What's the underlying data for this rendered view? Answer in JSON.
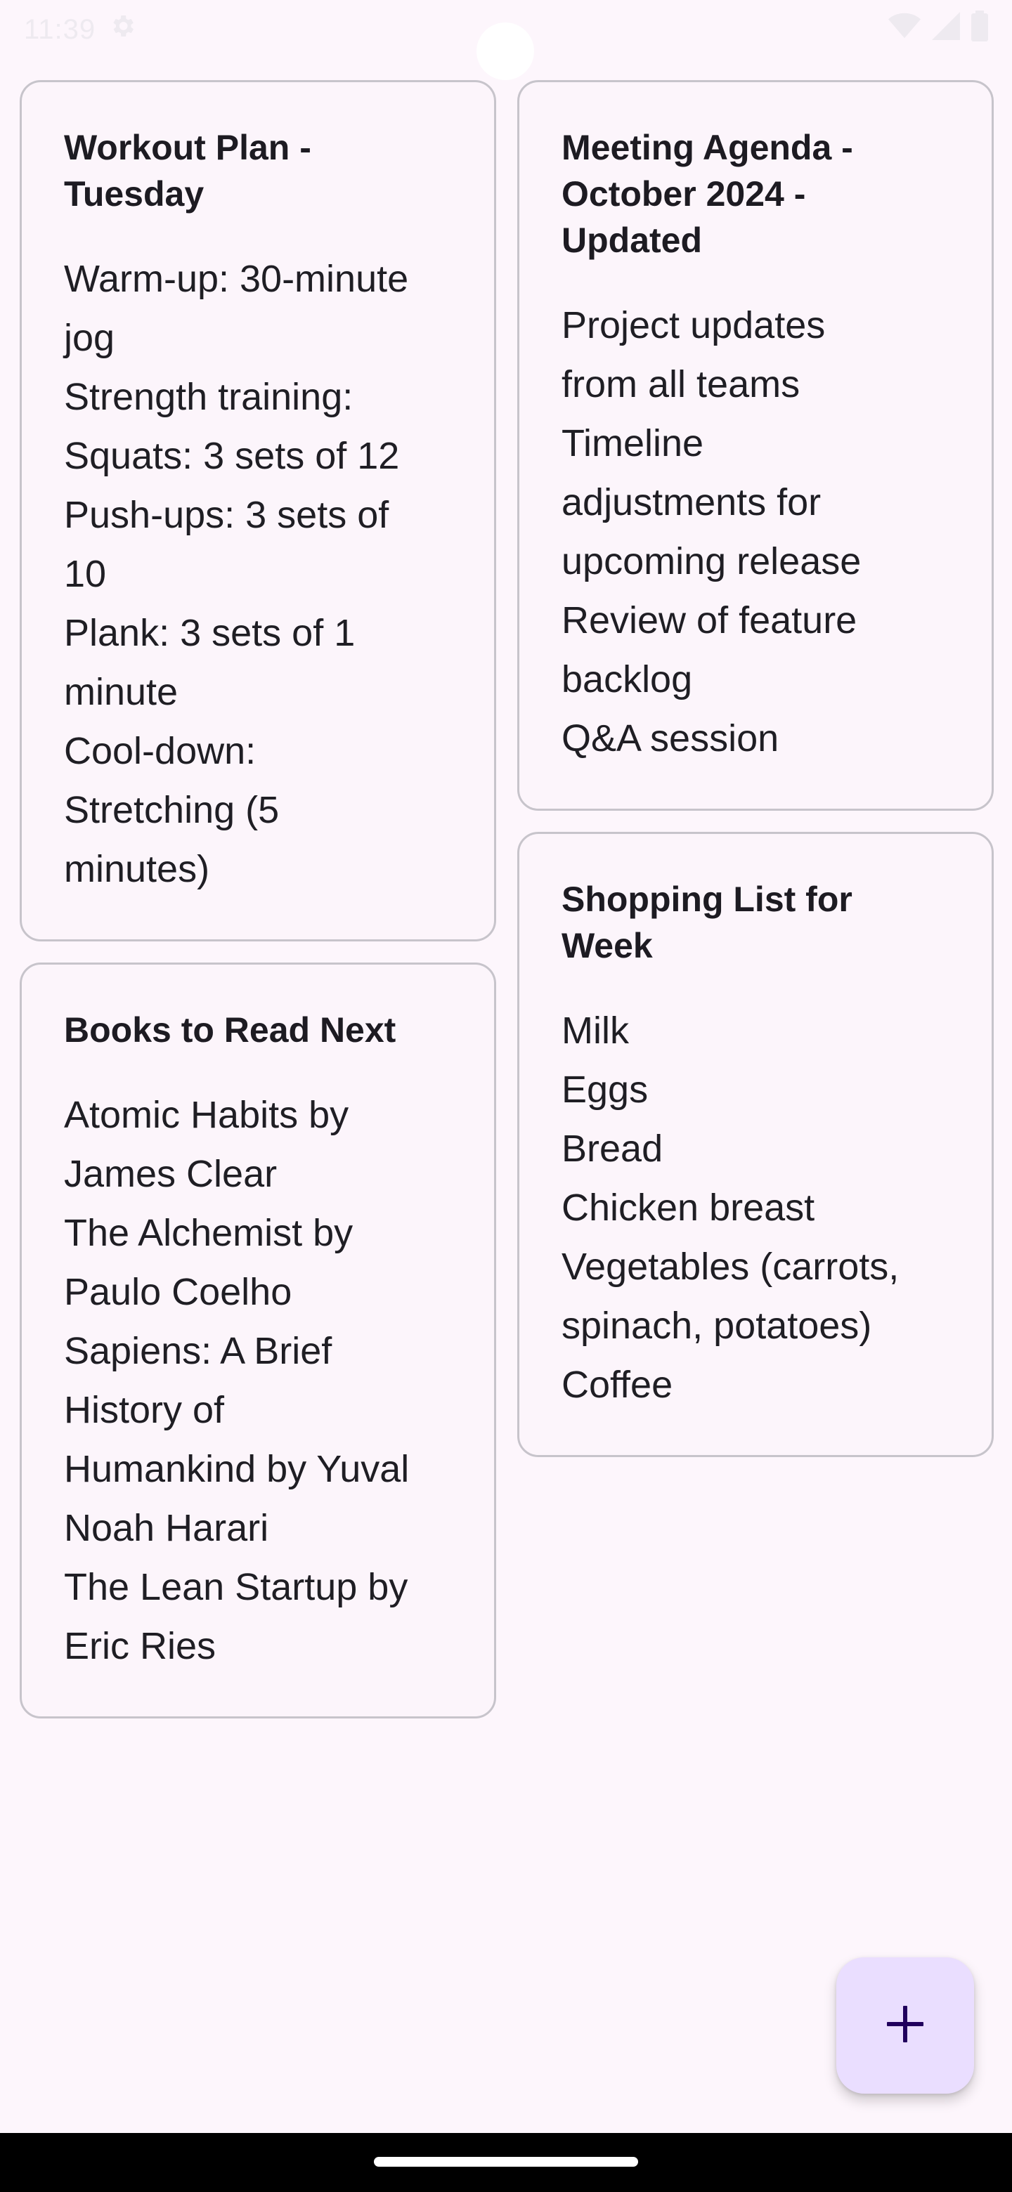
{
  "status_bar": {
    "time": "11:39",
    "icons": [
      "gear-icon",
      "wifi-icon",
      "signal-icon",
      "battery-icon"
    ]
  },
  "notes": {
    "left": [
      {
        "title": "Workout Plan - Tuesday",
        "lines": [
          "Warm-up: 30-minute",
          "jog",
          "Strength training:",
          "Squats: 3 sets of 12",
          "Push-ups: 3 sets of",
          "10",
          "Plank: 3 sets of 1",
          "minute",
          "Cool-down:",
          "Stretching (5",
          "minutes)"
        ]
      },
      {
        "title": "Books to Read Next",
        "lines": [
          "Atomic Habits by",
          "James Clear",
          "The Alchemist by",
          "Paulo Coelho",
          "Sapiens: A Brief",
          "History of",
          "Humankind by Yuval",
          "Noah Harari",
          "The Lean Startup by",
          "Eric Ries"
        ]
      }
    ],
    "right": [
      {
        "title": "Meeting Agenda - October 2024 - Updated",
        "lines": [
          "Project updates",
          "from all teams",
          "Timeline",
          "adjustments for",
          "upcoming release",
          "Review of feature",
          "backlog",
          "Q&A session"
        ]
      },
      {
        "title": "Shopping List for Week",
        "lines": [
          "Milk",
          "Eggs",
          "Bread",
          "Chicken breast",
          "Vegetables (carrots,",
          "spinach, potatoes)",
          "Coffee"
        ]
      }
    ]
  },
  "fab": {
    "icon": "plus-icon"
  },
  "colors": {
    "background": "#fdf6fc",
    "card_border": "#c7c4cb",
    "fab_background": "#eadeff",
    "fab_icon": "#21005d"
  }
}
